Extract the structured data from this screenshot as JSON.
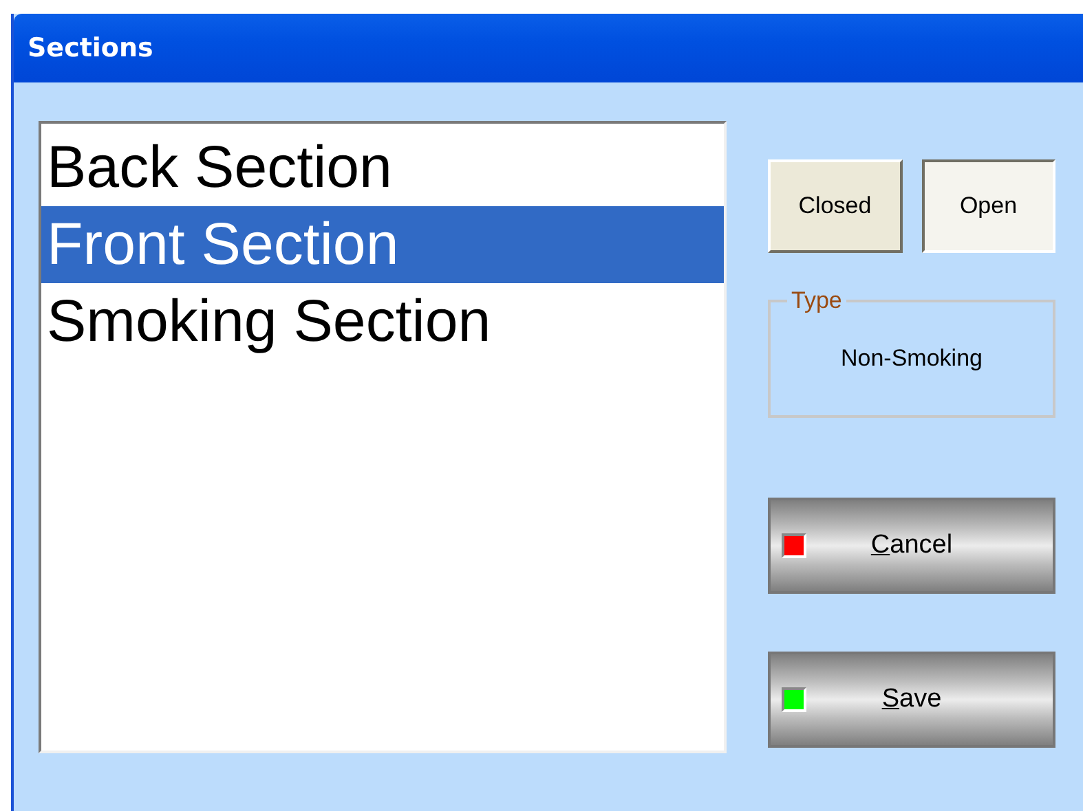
{
  "window": {
    "title": "Sections"
  },
  "list": {
    "items": [
      {
        "label": "Back Section",
        "selected": false
      },
      {
        "label": "Front Section",
        "selected": true
      },
      {
        "label": "Smoking Section",
        "selected": false
      }
    ]
  },
  "toggles": [
    {
      "label": "Closed",
      "selected": false
    },
    {
      "label": "Open",
      "selected": true
    }
  ],
  "type_group": {
    "legend": "Type",
    "value": "Non-Smoking"
  },
  "actions": [
    {
      "accel": "C",
      "rest": "ancel",
      "color": "#ff0000"
    },
    {
      "accel": "S",
      "rest": "ave",
      "color": "#00ff00"
    }
  ]
}
